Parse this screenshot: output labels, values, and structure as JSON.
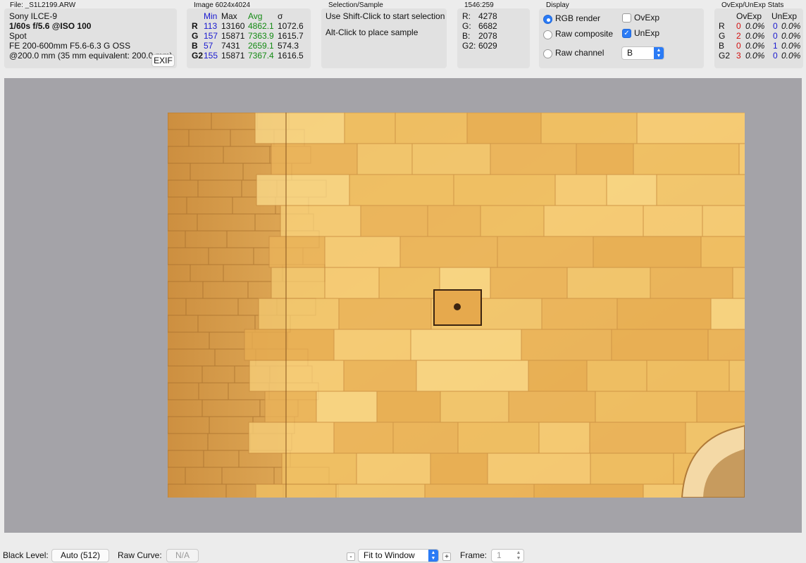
{
  "file_panel": {
    "title": "File: _S1L2199.ARW",
    "camera": "Sony ILCE-9",
    "exposure": "1/60s f/5.6 @ISO 100",
    "metering": "Spot",
    "lens": "FE 200-600mm F5.6-6.3 G OSS",
    "focal": "@200.0 mm (35 mm equivalent: 200.0 mm)",
    "exif_button": "EXIF"
  },
  "image_panel": {
    "title": "Image 6024x4024",
    "headers": {
      "min": "Min",
      "max": "Max",
      "avg": "Avg",
      "sigma": "σ"
    },
    "rows": [
      {
        "label": "R",
        "min": "113",
        "max": "13160",
        "avg": "4862.1",
        "sigma": "1072.6"
      },
      {
        "label": "G",
        "min": "157",
        "max": "15871",
        "avg": "7363.9",
        "sigma": "1615.7"
      },
      {
        "label": "B",
        "min": "57",
        "max": "7431",
        "avg": "2659.1",
        "sigma": "574.3"
      },
      {
        "label": "G2",
        "min": "155",
        "max": "15871",
        "avg": "7367.4",
        "sigma": "1616.5"
      }
    ]
  },
  "selection_panel": {
    "title": "Selection/Sample",
    "line1": "Use Shift-Click to start selection",
    "line2": "Alt-Click to place sample"
  },
  "pixel_panel": {
    "title": "1546:259",
    "rows": [
      {
        "label": "R:",
        "value": "4278"
      },
      {
        "label": "G:",
        "value": "6682"
      },
      {
        "label": "B:",
        "value": "2078"
      },
      {
        "label": "G2:",
        "value": "6029"
      }
    ]
  },
  "display_panel": {
    "title": "Display",
    "rgb_render": "RGB render",
    "raw_composite": "Raw composite",
    "raw_channel": "Raw channel",
    "ovexp": "OvExp",
    "unexp": "UnExp",
    "channel_value": "B",
    "selected_mode": "RGB render",
    "ovexp_checked": false,
    "unexp_checked": true
  },
  "stats_panel": {
    "title": "OvExp/UnExp Stats",
    "headers": {
      "ovexp": "OvExp",
      "unexp": "UnExp"
    },
    "rows": [
      {
        "label": "R",
        "ov_count": "0",
        "ov_pct": "0.0%",
        "un_count": "0",
        "un_pct": "0.0%"
      },
      {
        "label": "G",
        "ov_count": "2",
        "ov_pct": "0.0%",
        "un_count": "0",
        "un_pct": "0.0%"
      },
      {
        "label": "B",
        "ov_count": "0",
        "ov_pct": "0.0%",
        "un_count": "1",
        "un_pct": "0.0%"
      },
      {
        "label": "G2",
        "ov_count": "3",
        "ov_pct": "0.0%",
        "un_count": "0",
        "un_pct": "0.0%"
      }
    ]
  },
  "bottom_bar": {
    "black_level_label": "Black Level:",
    "black_level_value": "Auto (512)",
    "raw_curve_label": "Raw Curve:",
    "raw_curve_value": "N/A",
    "zoom_minus": "-",
    "zoom_value": "Fit to Window",
    "zoom_plus": "+",
    "frame_label": "Frame:",
    "frame_value": "1"
  },
  "colors": {
    "accent": "#2b7bf5",
    "min_blue": "#1a1ad0",
    "avg_green": "#138a13",
    "ovexp_red": "#d21010",
    "canvas_gray": "#a4a3a8"
  }
}
